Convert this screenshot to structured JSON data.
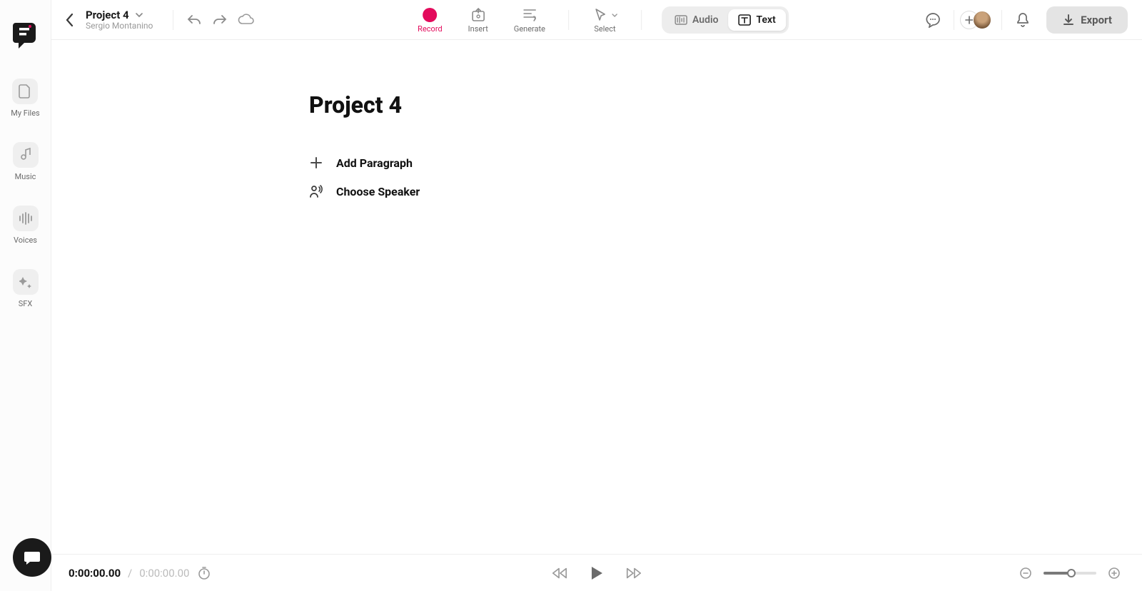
{
  "sidebar": {
    "items": [
      {
        "label": "My Files"
      },
      {
        "label": "Music"
      },
      {
        "label": "Voices"
      },
      {
        "label": "SFX"
      }
    ]
  },
  "header": {
    "project_title": "Project 4",
    "owner": "Sergio Montanino",
    "tools": {
      "record": "Record",
      "insert": "Insert",
      "generate": "Generate",
      "select": "Select"
    },
    "mode": {
      "audio": "Audio",
      "text": "Text"
    },
    "export": "Export"
  },
  "document": {
    "title": "Project 4",
    "actions": {
      "add_paragraph": "Add Paragraph",
      "choose_speaker": "Choose Speaker"
    }
  },
  "player": {
    "current_time": "0:00:00.00",
    "separator": "/",
    "total_time": "0:00:00.00",
    "zoom_percent": 48
  }
}
